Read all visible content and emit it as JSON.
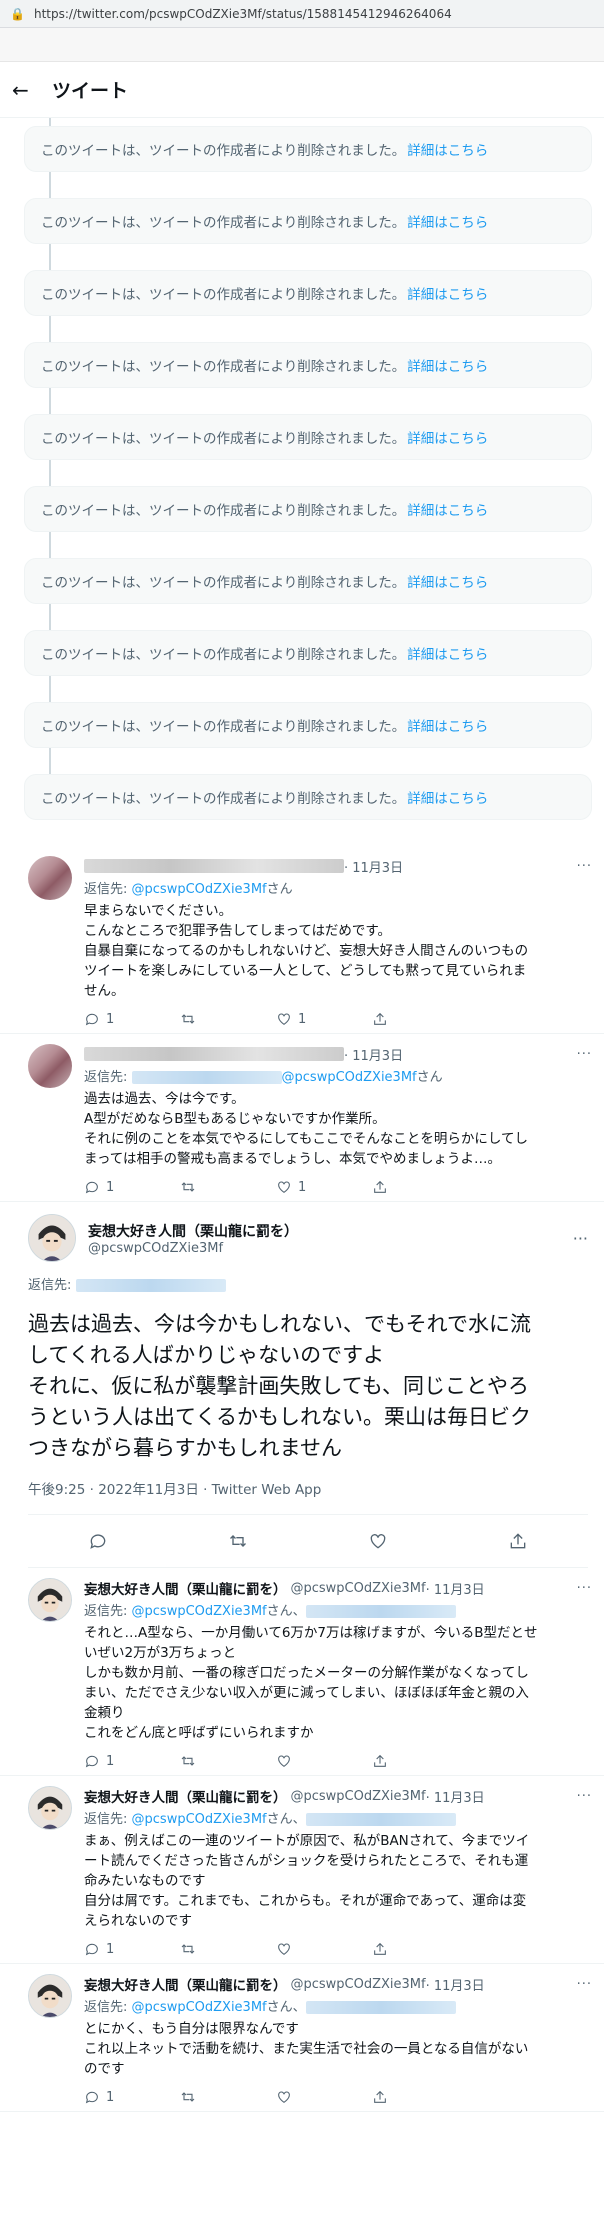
{
  "browser": {
    "url": "https://twitter.com/pcswpCOdZXie3Mf/status/1588145412946264064"
  },
  "header": {
    "back_icon": "arrow-left-icon",
    "title": "ツイート"
  },
  "deleted": {
    "message": "このツイートは、ツイートの作成者により削除されました。",
    "link": "詳細はこちら",
    "count": 10
  },
  "replies_before": [
    {
      "date": "· 11月3日",
      "reply_prefix": "返信先: ",
      "reply_handle": "@pcswpCOdZXie3Mf",
      "reply_suffix": "さん",
      "text": "早まらないでください。\nこんなところで犯罪予告してしまってはだめです。\n自暴自棄になってるのかもしれないけど、妄想大好き人間さんのいつもの\nツイートを楽しみにしている一人として、どうしても黙って見ていられま\nせん。",
      "replies": "1",
      "likes": "1"
    },
    {
      "date": "· 11月3日",
      "reply_prefix": "返信先: ",
      "reply_handle": "@pcswpCOdZXie3Mf",
      "reply_suffix": "さん",
      "text": "過去は過去、今は今です。\nA型がだめならB型もあるじゃないですか作業所。\nそれに例のことを本気でやるにしてもここでそんなことを明らかにしてし\nまっては相手の警戒も高まるでしょうし、本気でやめましょうよ…。",
      "replies": "1",
      "likes": "1"
    }
  ],
  "main": {
    "name": "妄想大好き人間（栗山龍に罰を）",
    "handle": "@pcswpCOdZXie3Mf",
    "reply_prefix": "返信先: ",
    "text": "過去は過去、今は今かもしれない、でもそれで水に流\nしてくれる人ばかりじゃないのですよ\nそれに、仮に私が襲撃計画失敗しても、同じことやろ\nうという人は出てくるかもしれない。栗山は毎日ビク\nつきながら暮らすかもしれません",
    "datetime": "午後9:25 · 2022年11月3日 · Twitter Web App"
  },
  "replies_after": [
    {
      "name": "妄想大好き人間（栗山龍に罰を）",
      "handle": "@pcswpCOdZXie3Mf",
      "date": "· 11月3日",
      "reply_prefix": "返信先: ",
      "reply_handle": "@pcswpCOdZXie3Mf",
      "reply_suffix": "さん、",
      "text": "それと…A型なら、一か月働いて6万か7万は稼げますが、今いるB型だとせ\nいぜい2万が3万ちょっと\nしかも数か月前、一番の稼ぎ口だったメーターの分解作業がなくなってし\nまい、ただでさえ少ない収入が更に減ってしまい、ほぼほぼ年金と親の入\n金頼り\nこれをどん底と呼ばずにいられますか",
      "replies": "1",
      "likes": ""
    },
    {
      "name": "妄想大好き人間（栗山龍に罰を）",
      "handle": "@pcswpCOdZXie3Mf",
      "date": "· 11月3日",
      "reply_prefix": "返信先: ",
      "reply_handle": "@pcswpCOdZXie3Mf",
      "reply_suffix": "さん、",
      "text": "まぁ、例えばこの一連のツイートが原因で、私がBANされて、今までツイ\nート読んでくださった皆さんがショックを受けられたところで、それも運\n命みたいなものです\n自分は屑です。これまでも、これからも。それが運命であって、運命は変\nえられないのです",
      "replies": "1",
      "likes": ""
    },
    {
      "name": "妄想大好き人間（栗山龍に罰を）",
      "handle": "@pcswpCOdZXie3Mf",
      "date": "· 11月3日",
      "reply_prefix": "返信先: ",
      "reply_handle": "@pcswpCOdZXie3Mf",
      "reply_suffix": "さん、",
      "text": "とにかく、もう自分は限界なんです\nこれ以上ネットで活動を続け、また実生活で社会の一員となる自信がない\nのです",
      "replies": "1",
      "likes": ""
    }
  ]
}
